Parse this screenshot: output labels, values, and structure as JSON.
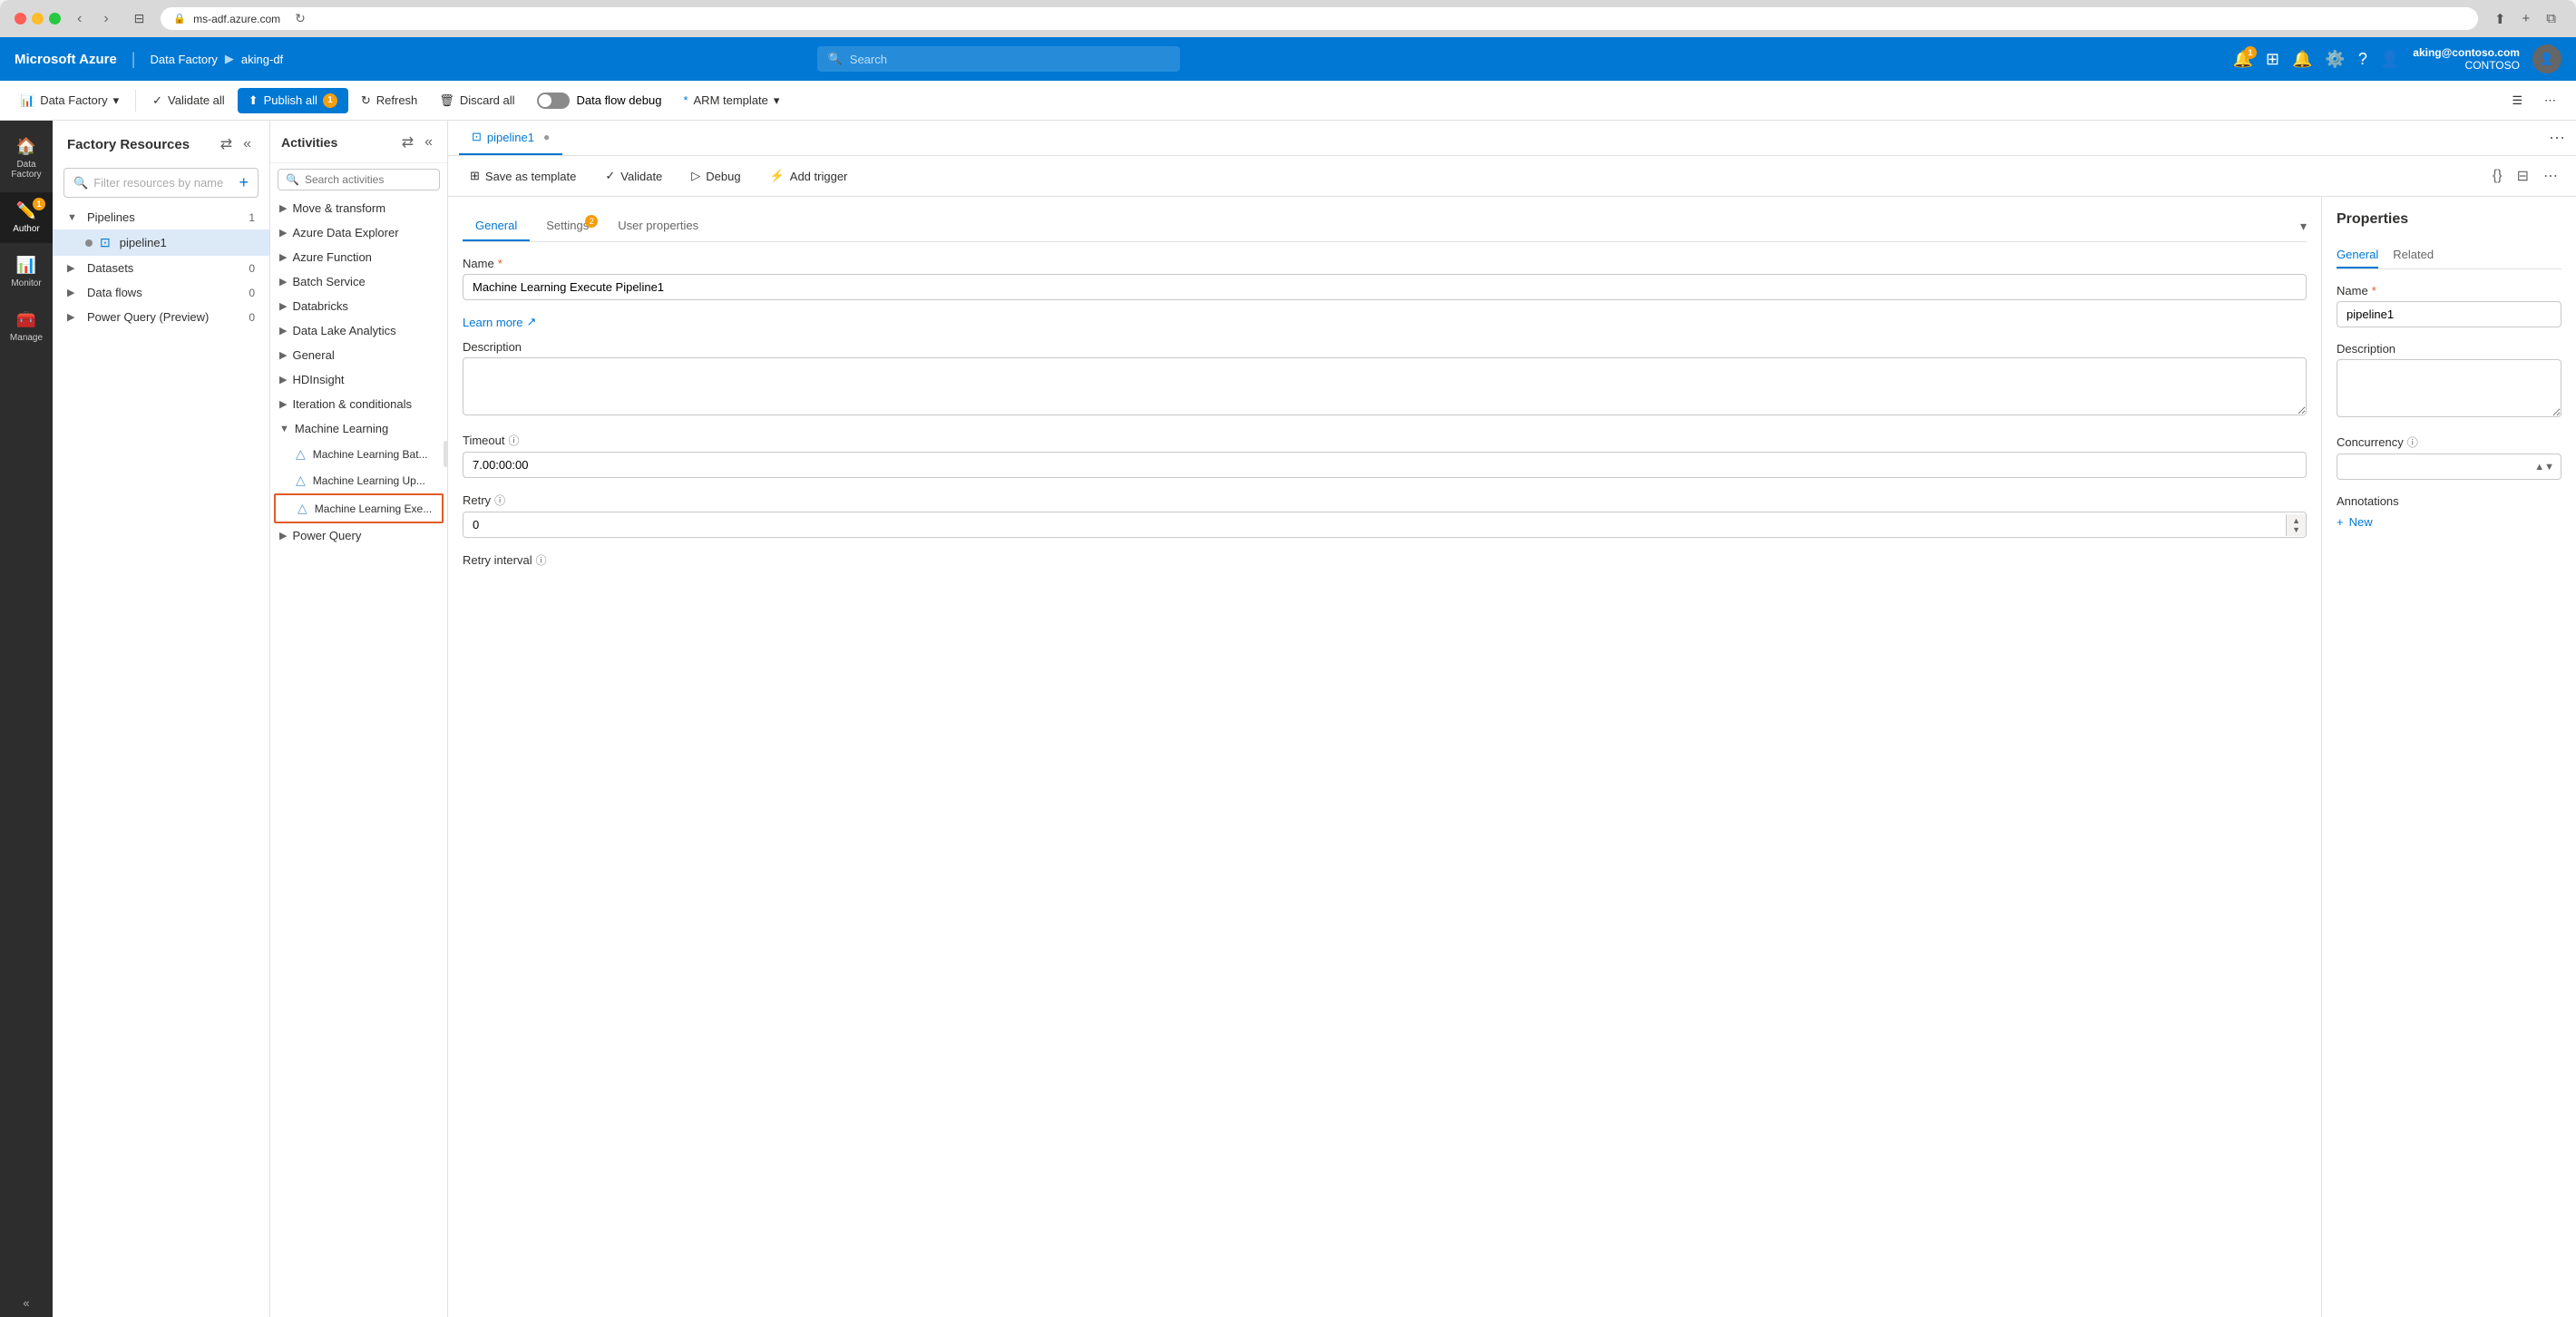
{
  "browser": {
    "url": "ms-adf.azure.com",
    "tab_icon": "🔒",
    "security_icon": "🛡"
  },
  "azure_header": {
    "app_name": "Microsoft Azure",
    "breadcrumb": [
      "Data Factory",
      "aking-df"
    ],
    "search_placeholder": "Search",
    "user_email": "aking@contoso.com",
    "user_org": "CONTOSO",
    "notification_badge": "1"
  },
  "app_toolbar": {
    "data_factory_label": "Data Factory",
    "validate_label": "Validate all",
    "publish_label": "Publish all",
    "publish_badge": "1",
    "refresh_label": "Refresh",
    "discard_label": "Discard all",
    "debug_label": "Data flow debug",
    "arm_label": "ARM template"
  },
  "sidebar_nav": {
    "items": [
      {
        "id": "data-factory",
        "icon": "🏠",
        "label": "Data Factory"
      },
      {
        "id": "author",
        "icon": "✏️",
        "label": "Author",
        "badge": "1"
      },
      {
        "id": "monitor",
        "icon": "📊",
        "label": "Monitor"
      },
      {
        "id": "manage",
        "icon": "🧰",
        "label": "Manage"
      }
    ],
    "collapse_icon": "«"
  },
  "factory_resources": {
    "title": "Factory Resources",
    "search_placeholder": "Filter resources by name",
    "tree": [
      {
        "label": "Pipelines",
        "count": "1",
        "expanded": true,
        "children": [
          {
            "label": "pipeline1",
            "selected": true,
            "has_dot": true
          }
        ]
      },
      {
        "label": "Datasets",
        "count": "0",
        "expanded": false
      },
      {
        "label": "Data flows",
        "count": "0",
        "expanded": false
      },
      {
        "label": "Power Query (Preview)",
        "count": "0",
        "expanded": false
      }
    ]
  },
  "activities": {
    "title": "Activities",
    "search_placeholder": "Search activities",
    "groups": [
      {
        "label": "Move & transform",
        "expanded": false
      },
      {
        "label": "Azure Data Explorer",
        "expanded": false
      },
      {
        "label": "Azure Function",
        "expanded": false
      },
      {
        "label": "Batch Service",
        "expanded": false
      },
      {
        "label": "Databricks",
        "expanded": false
      },
      {
        "label": "Data Lake Analytics",
        "expanded": false
      },
      {
        "label": "General",
        "expanded": false
      },
      {
        "label": "HDInsight",
        "expanded": false
      },
      {
        "label": "Iteration & conditionals",
        "expanded": false
      },
      {
        "label": "Machine Learning",
        "expanded": true,
        "children": [
          {
            "label": "Machine Learning Bat...",
            "icon": "🧪"
          },
          {
            "label": "Machine Learning Up...",
            "icon": "🧪"
          },
          {
            "label": "Machine Learning Exe...",
            "icon": "🧪",
            "highlighted": true
          }
        ]
      },
      {
        "label": "Power Query",
        "expanded": false
      }
    ]
  },
  "canvas_tab": {
    "label": "pipeline1"
  },
  "canvas_toolbar": {
    "save_as_template": "Save as template",
    "validate": "Validate",
    "debug": "Debug",
    "add_trigger": "Add trigger"
  },
  "activity_properties": {
    "tabs": [
      {
        "label": "General",
        "active": true
      },
      {
        "label": "Settings",
        "badge": "2"
      },
      {
        "label": "User properties"
      }
    ],
    "name_label": "Name",
    "name_value": "Machine Learning Execute Pipeline1",
    "learn_more": "Learn more",
    "description_label": "Description",
    "timeout_label": "Timeout",
    "timeout_value": "7.00:00:00",
    "retry_label": "Retry",
    "retry_value": "0",
    "retry_interval_label": "Retry interval"
  },
  "right_properties": {
    "title": "Properties",
    "tabs": [
      {
        "label": "General",
        "active": true
      },
      {
        "label": "Related"
      }
    ],
    "name_label": "Name",
    "name_value": "pipeline1",
    "description_label": "Description",
    "concurrency_label": "Concurrency",
    "annotations_label": "Annotations",
    "add_new_label": "+ New"
  }
}
